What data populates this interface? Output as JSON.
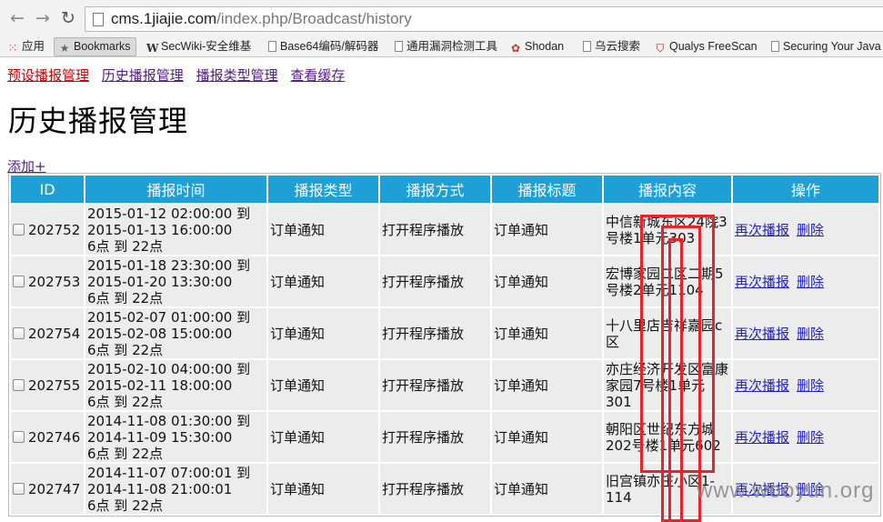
{
  "browser": {
    "url_host": "cms.1jiajie.com",
    "url_path": "/index.php/Broadcast/history",
    "bookmarks": [
      {
        "icon": "apps-icon",
        "label": "应用"
      },
      {
        "icon": "star-icon",
        "label": "Bookmarks"
      },
      {
        "icon": "wiki-icon",
        "label": "SecWiki-安全维基"
      },
      {
        "icon": "page-icon",
        "label": "Base64编码/解码器"
      },
      {
        "icon": "page-icon",
        "label": "通用漏洞检测工具"
      },
      {
        "icon": "shodan-icon",
        "label": "Shodan"
      },
      {
        "icon": "page-icon",
        "label": "乌云搜索"
      },
      {
        "icon": "qualys-icon",
        "label": "Qualys FreeScan"
      },
      {
        "icon": "page-icon",
        "label": "Securing Your Java"
      }
    ]
  },
  "nav": {
    "links": [
      "预设播报管理",
      "历史播报管理",
      "播报类型管理",
      "查看缓存"
    ]
  },
  "page": {
    "title": "历史播报管理",
    "add_link": "添加+"
  },
  "table": {
    "headers": [
      "ID",
      "播报时间",
      "播报类型",
      "播报方式",
      "播报标题",
      "播报内容",
      "操作"
    ],
    "rows": [
      {
        "id": "202752",
        "time_start": "2015-01-12 02:00:00 到",
        "time_end": "2015-01-13 16:00:00",
        "time_daily": "6点 到 22点",
        "type": "订单通知",
        "mode": "打开程序播放",
        "title": "订单通知",
        "content": "中信新城东区24院3号楼1单元303",
        "op1": "再次播报",
        "op2": "删除"
      },
      {
        "id": "202753",
        "time_start": "2015-01-18 23:30:00 到",
        "time_end": "2015-01-20 13:30:00",
        "time_daily": "6点 到 22点",
        "type": "订单通知",
        "mode": "打开程序播放",
        "title": "订单通知",
        "content": "宏博家园二区二期5号楼2单元1104",
        "op1": "再次播报",
        "op2": "删除"
      },
      {
        "id": "202754",
        "time_start": "2015-02-07 01:00:00 到",
        "time_end": "2015-02-08 15:00:00",
        "time_daily": "6点 到 22点",
        "type": "订单通知",
        "mode": "打开程序播放",
        "title": "订单通知",
        "content": "十八里店吉祥嘉园c区",
        "op1": "再次播报",
        "op2": "删除"
      },
      {
        "id": "202755",
        "time_start": "2015-02-10 04:00:00 到",
        "time_end": "2015-02-11 18:00:00",
        "time_daily": "6点 到 22点",
        "type": "订单通知",
        "mode": "打开程序播放",
        "title": "订单通知",
        "content": "亦庄经济开发区富康家园7号楼1单元301",
        "op1": "再次播报",
        "op2": "删除"
      },
      {
        "id": "202746",
        "time_start": "2014-11-08 01:30:00 到",
        "time_end": "2014-11-09 15:30:00",
        "time_daily": "6点 到 22点",
        "type": "订单通知",
        "mode": "打开程序播放",
        "title": "订单通知",
        "content": "朝阳区世纪东方城202号楼1单元602",
        "op1": "再次播报",
        "op2": "删除"
      },
      {
        "id": "202747",
        "time_start": "2014-11-07 07:00:01 到",
        "time_end": "2014-11-08 21:00:01",
        "time_daily": "6点 到 22点",
        "type": "订单通知",
        "mode": "打开程序播放",
        "title": "订单通知",
        "content": "旧宫镇亦庄小区1-114",
        "op1": "再次播报",
        "op2": "删除"
      }
    ]
  },
  "watermark": "www.wooyun.org",
  "colors": {
    "header_bg": "#1e9fd6",
    "row_bg": "#ececec",
    "redaction": "#e8242a"
  }
}
